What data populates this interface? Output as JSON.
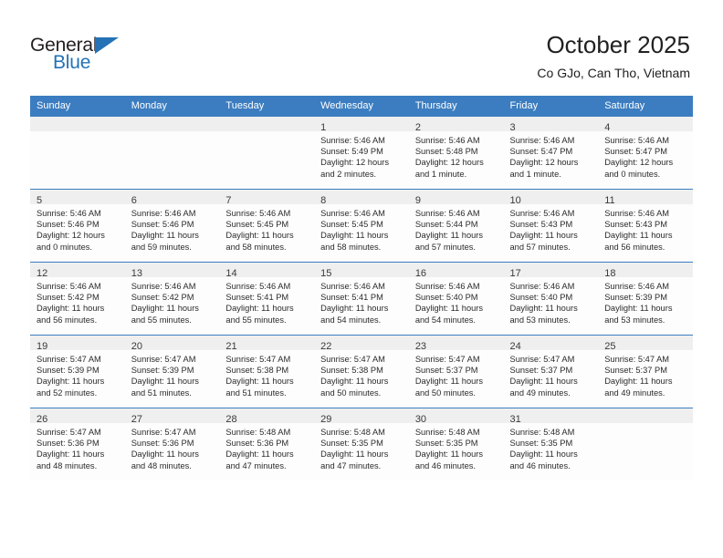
{
  "brand": {
    "name_top": "General",
    "name_bottom": "Blue",
    "accent_color": "#2572b6"
  },
  "header": {
    "title": "October 2025",
    "subtitle": "Co GJo, Can Tho, Vietnam"
  },
  "calendar": {
    "header_bg": "#3b7dc0",
    "daynum_bg": "#efefef",
    "weekday_headers": [
      "Sunday",
      "Monday",
      "Tuesday",
      "Wednesday",
      "Thursday",
      "Friday",
      "Saturday"
    ],
    "weeks": [
      [
        {
          "day": "",
          "lines": []
        },
        {
          "day": "",
          "lines": []
        },
        {
          "day": "",
          "lines": []
        },
        {
          "day": "1",
          "lines": [
            "Sunrise: 5:46 AM",
            "Sunset: 5:49 PM",
            "Daylight: 12 hours",
            "and 2 minutes."
          ]
        },
        {
          "day": "2",
          "lines": [
            "Sunrise: 5:46 AM",
            "Sunset: 5:48 PM",
            "Daylight: 12 hours",
            "and 1 minute."
          ]
        },
        {
          "day": "3",
          "lines": [
            "Sunrise: 5:46 AM",
            "Sunset: 5:47 PM",
            "Daylight: 12 hours",
            "and 1 minute."
          ]
        },
        {
          "day": "4",
          "lines": [
            "Sunrise: 5:46 AM",
            "Sunset: 5:47 PM",
            "Daylight: 12 hours",
            "and 0 minutes."
          ]
        }
      ],
      [
        {
          "day": "5",
          "lines": [
            "Sunrise: 5:46 AM",
            "Sunset: 5:46 PM",
            "Daylight: 12 hours",
            "and 0 minutes."
          ]
        },
        {
          "day": "6",
          "lines": [
            "Sunrise: 5:46 AM",
            "Sunset: 5:46 PM",
            "Daylight: 11 hours",
            "and 59 minutes."
          ]
        },
        {
          "day": "7",
          "lines": [
            "Sunrise: 5:46 AM",
            "Sunset: 5:45 PM",
            "Daylight: 11 hours",
            "and 58 minutes."
          ]
        },
        {
          "day": "8",
          "lines": [
            "Sunrise: 5:46 AM",
            "Sunset: 5:45 PM",
            "Daylight: 11 hours",
            "and 58 minutes."
          ]
        },
        {
          "day": "9",
          "lines": [
            "Sunrise: 5:46 AM",
            "Sunset: 5:44 PM",
            "Daylight: 11 hours",
            "and 57 minutes."
          ]
        },
        {
          "day": "10",
          "lines": [
            "Sunrise: 5:46 AM",
            "Sunset: 5:43 PM",
            "Daylight: 11 hours",
            "and 57 minutes."
          ]
        },
        {
          "day": "11",
          "lines": [
            "Sunrise: 5:46 AM",
            "Sunset: 5:43 PM",
            "Daylight: 11 hours",
            "and 56 minutes."
          ]
        }
      ],
      [
        {
          "day": "12",
          "lines": [
            "Sunrise: 5:46 AM",
            "Sunset: 5:42 PM",
            "Daylight: 11 hours",
            "and 56 minutes."
          ]
        },
        {
          "day": "13",
          "lines": [
            "Sunrise: 5:46 AM",
            "Sunset: 5:42 PM",
            "Daylight: 11 hours",
            "and 55 minutes."
          ]
        },
        {
          "day": "14",
          "lines": [
            "Sunrise: 5:46 AM",
            "Sunset: 5:41 PM",
            "Daylight: 11 hours",
            "and 55 minutes."
          ]
        },
        {
          "day": "15",
          "lines": [
            "Sunrise: 5:46 AM",
            "Sunset: 5:41 PM",
            "Daylight: 11 hours",
            "and 54 minutes."
          ]
        },
        {
          "day": "16",
          "lines": [
            "Sunrise: 5:46 AM",
            "Sunset: 5:40 PM",
            "Daylight: 11 hours",
            "and 54 minutes."
          ]
        },
        {
          "day": "17",
          "lines": [
            "Sunrise: 5:46 AM",
            "Sunset: 5:40 PM",
            "Daylight: 11 hours",
            "and 53 minutes."
          ]
        },
        {
          "day": "18",
          "lines": [
            "Sunrise: 5:46 AM",
            "Sunset: 5:39 PM",
            "Daylight: 11 hours",
            "and 53 minutes."
          ]
        }
      ],
      [
        {
          "day": "19",
          "lines": [
            "Sunrise: 5:47 AM",
            "Sunset: 5:39 PM",
            "Daylight: 11 hours",
            "and 52 minutes."
          ]
        },
        {
          "day": "20",
          "lines": [
            "Sunrise: 5:47 AM",
            "Sunset: 5:39 PM",
            "Daylight: 11 hours",
            "and 51 minutes."
          ]
        },
        {
          "day": "21",
          "lines": [
            "Sunrise: 5:47 AM",
            "Sunset: 5:38 PM",
            "Daylight: 11 hours",
            "and 51 minutes."
          ]
        },
        {
          "day": "22",
          "lines": [
            "Sunrise: 5:47 AM",
            "Sunset: 5:38 PM",
            "Daylight: 11 hours",
            "and 50 minutes."
          ]
        },
        {
          "day": "23",
          "lines": [
            "Sunrise: 5:47 AM",
            "Sunset: 5:37 PM",
            "Daylight: 11 hours",
            "and 50 minutes."
          ]
        },
        {
          "day": "24",
          "lines": [
            "Sunrise: 5:47 AM",
            "Sunset: 5:37 PM",
            "Daylight: 11 hours",
            "and 49 minutes."
          ]
        },
        {
          "day": "25",
          "lines": [
            "Sunrise: 5:47 AM",
            "Sunset: 5:37 PM",
            "Daylight: 11 hours",
            "and 49 minutes."
          ]
        }
      ],
      [
        {
          "day": "26",
          "lines": [
            "Sunrise: 5:47 AM",
            "Sunset: 5:36 PM",
            "Daylight: 11 hours",
            "and 48 minutes."
          ]
        },
        {
          "day": "27",
          "lines": [
            "Sunrise: 5:47 AM",
            "Sunset: 5:36 PM",
            "Daylight: 11 hours",
            "and 48 minutes."
          ]
        },
        {
          "day": "28",
          "lines": [
            "Sunrise: 5:48 AM",
            "Sunset: 5:36 PM",
            "Daylight: 11 hours",
            "and 47 minutes."
          ]
        },
        {
          "day": "29",
          "lines": [
            "Sunrise: 5:48 AM",
            "Sunset: 5:35 PM",
            "Daylight: 11 hours",
            "and 47 minutes."
          ]
        },
        {
          "day": "30",
          "lines": [
            "Sunrise: 5:48 AM",
            "Sunset: 5:35 PM",
            "Daylight: 11 hours",
            "and 46 minutes."
          ]
        },
        {
          "day": "31",
          "lines": [
            "Sunrise: 5:48 AM",
            "Sunset: 5:35 PM",
            "Daylight: 11 hours",
            "and 46 minutes."
          ]
        },
        {
          "day": "",
          "lines": []
        }
      ]
    ]
  }
}
